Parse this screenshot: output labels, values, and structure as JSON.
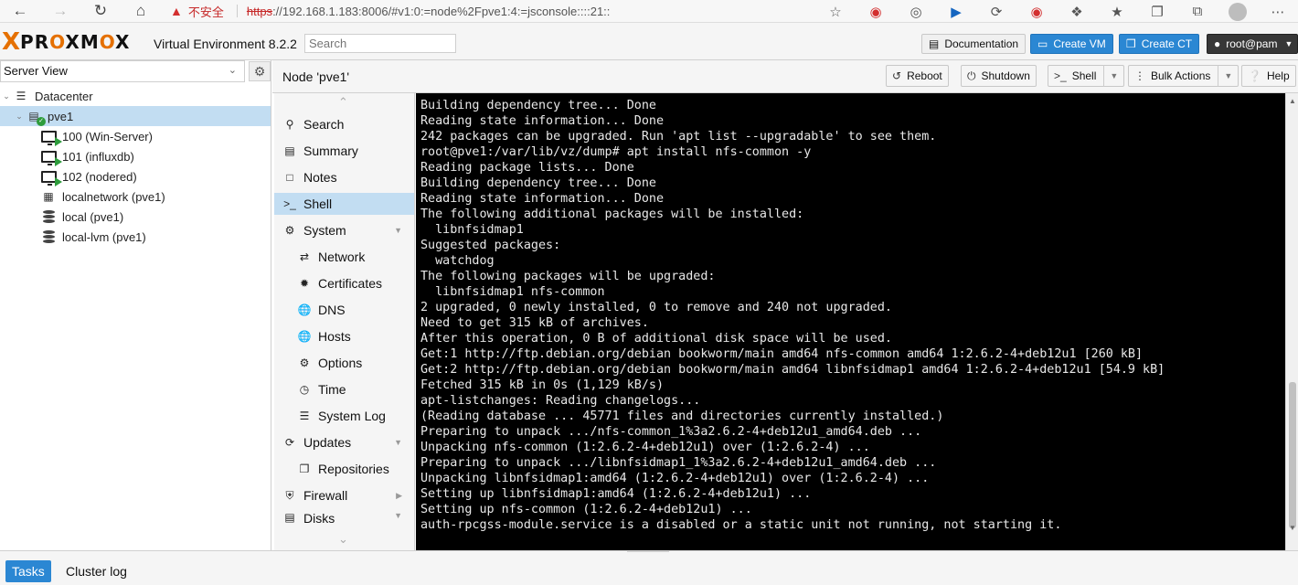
{
  "browser": {
    "security_label": "不安全",
    "url_scheme": "https",
    "url_rest": "://192.168.1.183:8006/#v1:0:=node%2Fpve1:4:=jsconsole::::21::"
  },
  "header": {
    "logo_prefix": "X",
    "logo_text_1": "PR",
    "logo_o1": "O",
    "logo_text_2": "XM",
    "logo_o2": "O",
    "logo_text_3": "X",
    "version": "Virtual Environment 8.2.2",
    "search_placeholder": "Search",
    "documentation": "Documentation",
    "create_vm": "Create VM",
    "create_ct": "Create CT",
    "user": "root@pam"
  },
  "left": {
    "view": "Server View",
    "tree": [
      {
        "label": "Datacenter"
      },
      {
        "label": "pve1"
      },
      {
        "label": "100 (Win-Server)"
      },
      {
        "label": "101 (influxdb)"
      },
      {
        "label": "102 (nodered)"
      },
      {
        "label": "localnetwork (pve1)"
      },
      {
        "label": "local (pve1)"
      },
      {
        "label": "local-lvm (pve1)"
      }
    ]
  },
  "node": {
    "title": "Node 'pve1'",
    "reboot": "Reboot",
    "shutdown": "Shutdown",
    "shell": "Shell",
    "bulk_actions": "Bulk Actions",
    "help": "Help"
  },
  "menu": [
    {
      "label": "Search"
    },
    {
      "label": "Summary"
    },
    {
      "label": "Notes"
    },
    {
      "label": "Shell"
    },
    {
      "label": "System"
    },
    {
      "label": "Network"
    },
    {
      "label": "Certificates"
    },
    {
      "label": "DNS"
    },
    {
      "label": "Hosts"
    },
    {
      "label": "Options"
    },
    {
      "label": "Time"
    },
    {
      "label": "System Log"
    },
    {
      "label": "Updates"
    },
    {
      "label": "Repositories"
    },
    {
      "label": "Firewall"
    },
    {
      "label": "Disks"
    }
  ],
  "terminal_lines": [
    "Building dependency tree... Done",
    "Reading state information... Done",
    "242 packages can be upgraded. Run 'apt list --upgradable' to see them.",
    "root@pve1:/var/lib/vz/dump# apt install nfs-common -y",
    "Reading package lists... Done",
    "Building dependency tree... Done",
    "Reading state information... Done",
    "The following additional packages will be installed:",
    "  libnfsidmap1",
    "Suggested packages:",
    "  watchdog",
    "The following packages will be upgraded:",
    "  libnfsidmap1 nfs-common",
    "2 upgraded, 0 newly installed, 0 to remove and 240 not upgraded.",
    "Need to get 315 kB of archives.",
    "After this operation, 0 B of additional disk space will be used.",
    "Get:1 http://ftp.debian.org/debian bookworm/main amd64 nfs-common amd64 1:2.6.2-4+deb12u1 [260 kB]",
    "Get:2 http://ftp.debian.org/debian bookworm/main amd64 libnfsidmap1 amd64 1:2.6.2-4+deb12u1 [54.9 kB]",
    "Fetched 315 kB in 0s (1,129 kB/s)",
    "apt-listchanges: Reading changelogs...",
    "(Reading database ... 45771 files and directories currently installed.)",
    "Preparing to unpack .../nfs-common_1%3a2.6.2-4+deb12u1_amd64.deb ...",
    "Unpacking nfs-common (1:2.6.2-4+deb12u1) over (1:2.6.2-4) ...",
    "Preparing to unpack .../libnfsidmap1_1%3a2.6.2-4+deb12u1_amd64.deb ...",
    "Unpacking libnfsidmap1:amd64 (1:2.6.2-4+deb12u1) over (1:2.6.2-4) ...",
    "Setting up libnfsidmap1:amd64 (1:2.6.2-4+deb12u1) ...",
    "Setting up nfs-common (1:2.6.2-4+deb12u1) ...",
    "auth-rpcgss-module.service is a disabled or a static unit not running, not starting it."
  ],
  "bottom": {
    "tasks": "Tasks",
    "cluster_log": "Cluster log"
  },
  "colors": {
    "accent": "#2b87d3",
    "selected": "#c2ddf2",
    "brand_orange": "#e57000",
    "running": "#2e9c3c"
  }
}
